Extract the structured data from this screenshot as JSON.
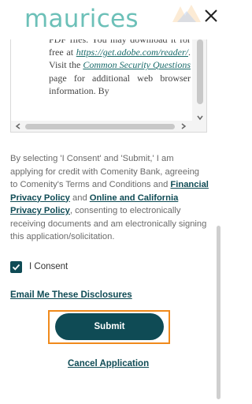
{
  "header": {
    "logo_text": "maurices",
    "close_icon": "close-icon"
  },
  "disclosure": {
    "lines_before_link": "PDF files. You may download it for free at",
    "adobe_link": "https://get.adobe.com/reader/",
    "visit_prefix": ". Visit the",
    "security_link": "Common Security Questions",
    "visit_suffix": "page for additional web browser information. By"
  },
  "consent": {
    "part1": "By selecting 'I Consent' and 'Submit,' I am applying for credit with Comenity Bank, agreeing to Comenity's Terms and Conditions and",
    "financial_privacy_link": "Financial Privacy Policy",
    "and_text": "and",
    "online_privacy_link": "Online and California Privacy Policy",
    "part2": ", consenting to electronically receiving documents and am electronically signing this application/solicitation."
  },
  "checkbox": {
    "label": "I Consent",
    "checked": true
  },
  "links": {
    "email_disclosures": "Email Me These Disclosures",
    "cancel": "Cancel Application"
  },
  "buttons": {
    "submit": "Submit"
  },
  "colors": {
    "brand_teal": "#6cc0b8",
    "dark_teal": "#0f4b55",
    "focus_orange": "#f08a1c"
  }
}
